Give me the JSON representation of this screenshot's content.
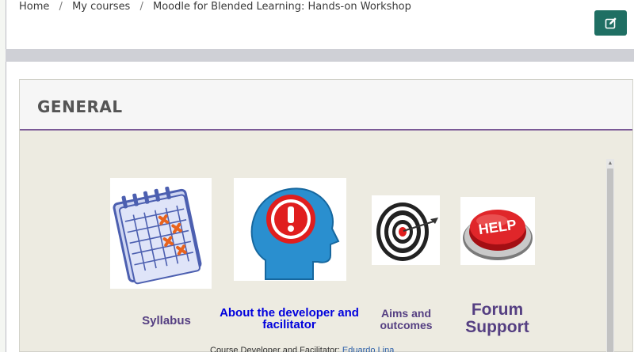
{
  "breadcrumb": {
    "items": [
      "Home",
      "My courses",
      "Moodle for Blended Learning: Hands-on Workshop"
    ],
    "separator": "/"
  },
  "toolbar": {
    "edit_icon": "pencil-square-icon",
    "accent": "#1f6f63"
  },
  "section": {
    "title": "GENERAL",
    "divider_color": "#7b5a97"
  },
  "tiles": {
    "syllabus": {
      "label": "Syllabus",
      "icon": "calendar-icon"
    },
    "about": {
      "label": "About the developer and facilitator",
      "icon": "head-exclamation-icon"
    },
    "aims": {
      "label": "Aims and outcomes",
      "icon": "target-icon"
    },
    "forum": {
      "label": "Forum Support",
      "icon": "help-button-icon"
    }
  },
  "developer": {
    "prefix": "Course Developer and Facilitator:",
    "name": "Eduardo Lina"
  },
  "colors": {
    "label_purple": "#553f82",
    "link_blue": "#0000dd"
  }
}
